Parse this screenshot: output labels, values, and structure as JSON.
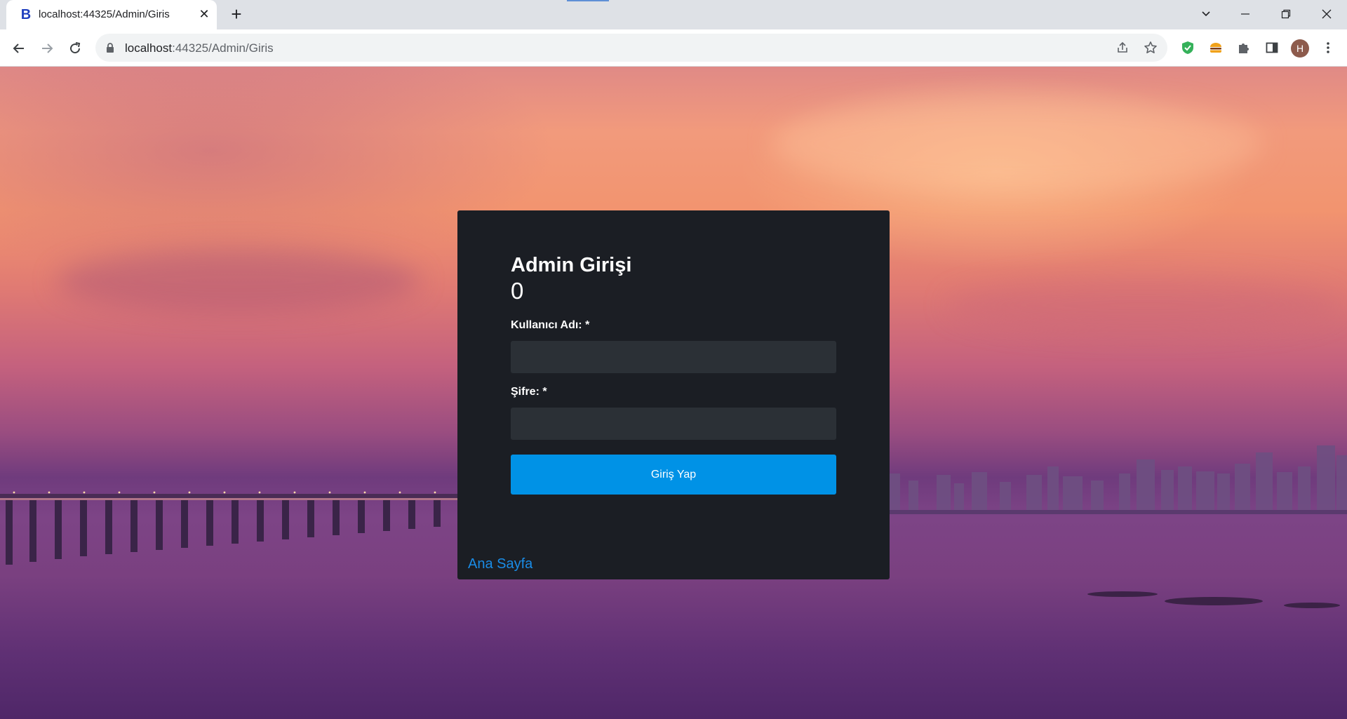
{
  "browser": {
    "tab": {
      "title": "localhost:44325/Admin/Giris",
      "favicon_letter": "B",
      "favicon_color": "#1f3fbf"
    },
    "url": {
      "host": "localhost",
      "rest": ":44325/Admin/Giris"
    },
    "profile_initial": "H",
    "icons": {
      "back": "arrow-left-icon",
      "forward": "arrow-right-icon",
      "reload": "reload-icon",
      "lock": "lock-icon",
      "share": "share-icon",
      "bookmark": "star-icon",
      "extension_1": "shield-check-icon",
      "extension_2": "burger-icon",
      "extensions": "puzzle-icon",
      "side_panel": "side-panel-icon",
      "menu": "kebab-menu-icon"
    }
  },
  "login": {
    "title": "Admin Girişi",
    "counter": "0",
    "username_label": "Kullanıcı Adı: *",
    "username_value": "",
    "password_label": "Şifre: *",
    "password_value": "",
    "submit_label": "Giriş Yap",
    "home_link": "Ana Sayfa"
  },
  "colors": {
    "card_bg": "#1b1e24",
    "input_bg": "#2b3036",
    "button_bg": "#0092e6",
    "link": "#1a8ce6"
  }
}
